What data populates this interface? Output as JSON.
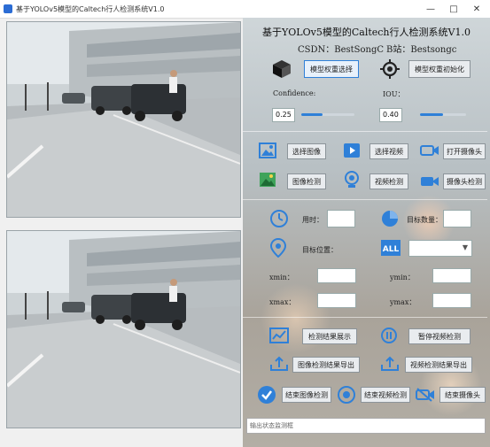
{
  "window": {
    "title": "基于YOLOv5模型的Caltech行人检测系统V1.0"
  },
  "header": {
    "title": "基于YOLOv5模型的Caltech行人检测系统V1.0",
    "csdn": "CSDN：BestSongC",
    "bilibili": "B站：Bestsongc"
  },
  "model": {
    "select_label": "模型权重选择",
    "init_label": "模型权重初始化"
  },
  "params": {
    "confidence_label": "Confidence:",
    "confidence_value": "0.25",
    "confidence_level": 0.25,
    "iou_label": "IOU：",
    "iou_value": "0.40",
    "iou_level": 0.4
  },
  "input": {
    "select_image": "选择图像",
    "select_video": "选择视频",
    "open_camera": "打开摄像头",
    "image_detect": "图像检测",
    "video_detect": "视频检测",
    "camera_detect": "摄像头检测"
  },
  "results": {
    "time_label": "用时：",
    "time_value": "",
    "target_count_label": "目标数量：",
    "target_count_value": "",
    "target_position_label": "目标位置：",
    "xmin_label": "xmin：",
    "ymin_label": "ymin：",
    "xmax_label": "xmax：",
    "ymax_label": "ymax：",
    "xmin_value": "",
    "ymin_value": "",
    "xmax_value": "",
    "ymax_value": "",
    "class_select_value": ""
  },
  "actions": {
    "show_results": "检测结果展示",
    "pause_video": "暂停视频检测",
    "export_image": "图像检测结果导出",
    "export_video": "视频检测结果导出",
    "end_image": "结束图像检测",
    "end_video": "结束视频检测",
    "end_camera": "结束摄像头"
  },
  "status": {
    "placeholder": "输出状态监测框"
  },
  "colors": {
    "accent": "#2f80d8"
  }
}
